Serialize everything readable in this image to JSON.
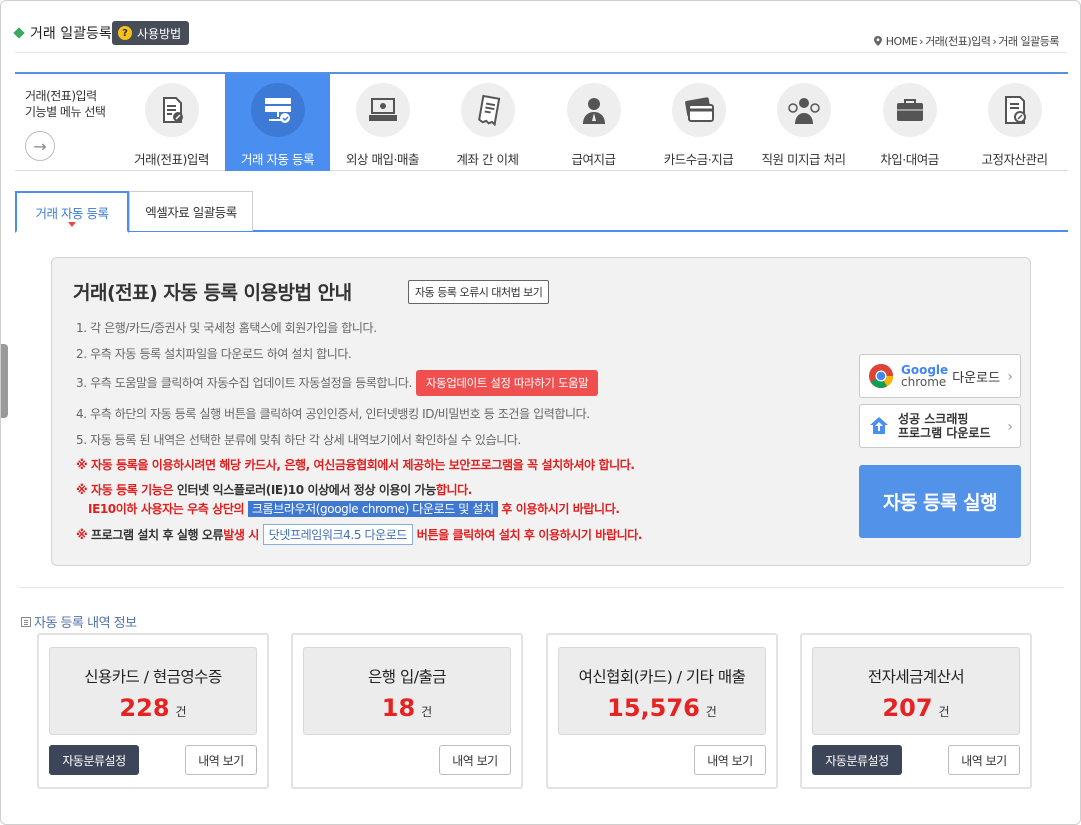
{
  "header": {
    "title": "거래 일괄등록",
    "howto_label": "사용방법",
    "breadcrumb": [
      "HOME",
      "거래(전표)입력",
      "거래 일괄등록"
    ]
  },
  "menu": {
    "lead_line1": "거래(전표)입력",
    "lead_line2": "기능별 메뉴 선택",
    "items": [
      {
        "label": "거래(전표)입력",
        "icon": "document-pen-icon"
      },
      {
        "label": "거래 자동 등록",
        "icon": "server-sync-icon",
        "active": true
      },
      {
        "label": "외상 매입·매출",
        "icon": "cash-register-icon"
      },
      {
        "label": "계좌 간 이체",
        "icon": "receipt-icon"
      },
      {
        "label": "급여지급",
        "icon": "person-icon"
      },
      {
        "label": "카드수금·지급",
        "icon": "credit-card-icon"
      },
      {
        "label": "직원 미지급 처리",
        "icon": "employee-money-icon"
      },
      {
        "label": "차입·대여금",
        "icon": "briefcase-icon"
      },
      {
        "label": "고정자산관리",
        "icon": "asset-document-icon"
      }
    ]
  },
  "subtabs": [
    {
      "label": "거래 자동 등록",
      "active": true
    },
    {
      "label": "엑셀자료 일괄등록"
    }
  ],
  "guide": {
    "title": "거래(전표) 자동 등록 이용방법 안내",
    "fix_button": "자동 등록 오류시 대처법 보기",
    "step1": "1. 각 은행/카드/증권사 및 국세청 홈택스에 회원가입을 합니다.",
    "step2": "2. 우측 자동 등록 설치파일을 다운로드 하여 설치 합니다.",
    "step3": "3. 우측 도움말을 클릭하여 자동수집 업데이트 자동설정을 등록합니다.",
    "step3_button": "자동업데이트 설정 따라하기 도움말",
    "step4": "4. 우측 하단의 자동 등록 실행 버튼을 클릭하여 공인인증서, 인터넷뱅킹 ID/비밀번호 등 조건을 입력합니다.",
    "step5": "5. 자동 등록 된 내역은 선택한 분류에 맞춰 하단 각 상세 내역보기에서 확인하실 수 있습니다.",
    "note1": "※ 자동 등록을 이용하시려면 해당 카드사, 은행, 여신금융협회에서 제공하는 보안프로그램을 꼭 설치하셔야 합니다.",
    "note2_a": "※ 자동 등록 기능은 ",
    "note2_b": "인터넷 익스플로러(IE)10 이상에서 정상 이용이 가능",
    "note2_c": "합니다.",
    "note2_d": "IE10이하 사용자는 우측 상단의 ",
    "note2_e": "크롬브라우저(google chrome) 다운로드 및 설치",
    "note2_f": " 후 이용하시기 바랍니다.",
    "note3_a": "※ ",
    "note3_b": "프로그램 설치 후 실행 오류",
    "note3_c": "발생 시 ",
    "note3_d": "닷넷프레임워크4.5 다운로드",
    "note3_e": " 버튼을 클릭하여 설치 후 이용하시기 바랍니다.",
    "chrome_brand_1": "Google",
    "chrome_brand_2": "chrome",
    "chrome_download": "다운로드",
    "scraping_line1": "성공 스크래핑",
    "scraping_line2": "프로그램 다운로드",
    "run_button": "자동 등록 실행"
  },
  "section": {
    "title": "자동 등록 내역 정보",
    "unit": "건",
    "auto_label": "자동분류설정",
    "view_label": "내역 보기",
    "cards": [
      {
        "title": "신용카드 / 현금영수증",
        "count": "228",
        "has_auto": true
      },
      {
        "title": "은행 입/출금",
        "count": "18",
        "has_auto": false
      },
      {
        "title": "여신협회(카드) / 기타 매출",
        "count": "15,576",
        "has_auto": false
      },
      {
        "title": "전자세금계산서",
        "count": "207",
        "has_auto": true
      }
    ]
  },
  "colors": {
    "accent": "#4a8ef0",
    "danger": "#e02020",
    "dark_button": "#3d4558"
  }
}
